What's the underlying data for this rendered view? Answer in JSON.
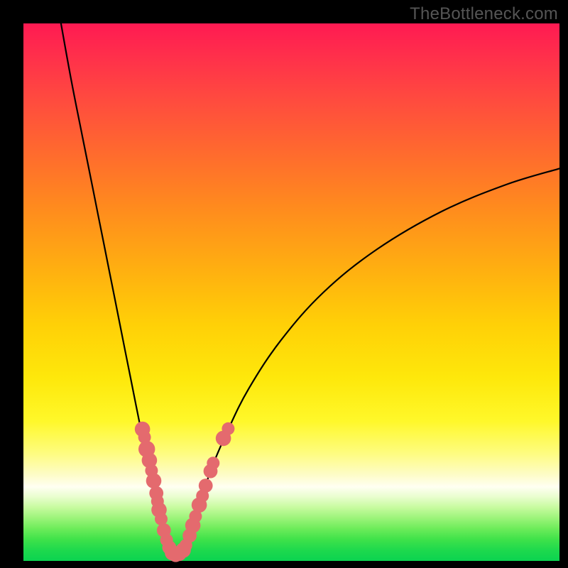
{
  "watermark": "TheBottleneck.com",
  "colors": {
    "frame": "#000000",
    "curve": "#000000",
    "dot": "#e46a6e",
    "gradient_top": "#ff1a52",
    "gradient_mid1": "#ffb010",
    "gradient_mid2": "#fff82a",
    "gradient_pale": "#fffff2",
    "gradient_bottom": "#0bd350"
  },
  "chart_data": {
    "type": "line",
    "title": "",
    "xlabel": "",
    "ylabel": "",
    "xlim": [
      0,
      100
    ],
    "ylim": [
      0,
      100
    ],
    "grid": false,
    "legend": false,
    "series": [
      {
        "name": "left-branch",
        "x": [
          7,
          9,
          11,
          13,
          15,
          17,
          19,
          21,
          23,
          24,
          25,
          26,
          27,
          28
        ],
        "y": [
          100,
          89,
          79,
          69,
          59,
          49,
          39,
          29,
          19,
          14,
          10,
          6,
          3,
          1
        ]
      },
      {
        "name": "right-branch",
        "x": [
          28,
          29,
          30,
          31.5,
          33,
          35,
          38,
          42,
          48,
          56,
          66,
          78,
          90,
          100
        ],
        "y": [
          1,
          2,
          4,
          7,
          11,
          17,
          24,
          32,
          41,
          50,
          58,
          65,
          70,
          73
        ]
      },
      {
        "name": "valley-floor",
        "x": [
          25.5,
          26.2,
          27.1,
          27.9,
          28.6,
          29.4,
          30.0
        ],
        "y": [
          1.5,
          0.9,
          0.6,
          0.5,
          0.7,
          1.1,
          1.7
        ]
      }
    ],
    "scatter_points": {
      "name": "highlighted-points",
      "points": [
        {
          "x": 22.2,
          "y": 24.5,
          "r": 1.2
        },
        {
          "x": 22.6,
          "y": 23.0,
          "r": 1.0
        },
        {
          "x": 23.0,
          "y": 20.8,
          "r": 1.3
        },
        {
          "x": 23.5,
          "y": 18.7,
          "r": 1.2
        },
        {
          "x": 23.9,
          "y": 16.8,
          "r": 1.0
        },
        {
          "x": 24.3,
          "y": 14.9,
          "r": 1.2
        },
        {
          "x": 24.8,
          "y": 12.6,
          "r": 1.1
        },
        {
          "x": 25.0,
          "y": 11.1,
          "r": 1.0
        },
        {
          "x": 25.3,
          "y": 9.5,
          "r": 1.2
        },
        {
          "x": 25.7,
          "y": 7.8,
          "r": 1.0
        },
        {
          "x": 26.2,
          "y": 5.7,
          "r": 1.1
        },
        {
          "x": 26.7,
          "y": 3.9,
          "r": 1.0
        },
        {
          "x": 27.2,
          "y": 2.5,
          "r": 1.1
        },
        {
          "x": 27.8,
          "y": 1.5,
          "r": 1.2
        },
        {
          "x": 28.4,
          "y": 1.1,
          "r": 1.1
        },
        {
          "x": 29.1,
          "y": 1.3,
          "r": 1.1
        },
        {
          "x": 29.8,
          "y": 2.0,
          "r": 1.2
        },
        {
          "x": 30.3,
          "y": 2.9,
          "r": 1.0
        },
        {
          "x": 31.0,
          "y": 4.7,
          "r": 1.1
        },
        {
          "x": 31.6,
          "y": 6.6,
          "r": 1.2
        },
        {
          "x": 32.1,
          "y": 8.3,
          "r": 1.0
        },
        {
          "x": 32.8,
          "y": 10.4,
          "r": 1.2
        },
        {
          "x": 33.4,
          "y": 12.1,
          "r": 1.0
        },
        {
          "x": 34.0,
          "y": 14.0,
          "r": 1.1
        },
        {
          "x": 34.9,
          "y": 16.7,
          "r": 1.1
        },
        {
          "x": 35.4,
          "y": 18.2,
          "r": 1.0
        },
        {
          "x": 37.3,
          "y": 22.8,
          "r": 1.2
        },
        {
          "x": 38.2,
          "y": 24.6,
          "r": 1.0
        }
      ]
    }
  }
}
